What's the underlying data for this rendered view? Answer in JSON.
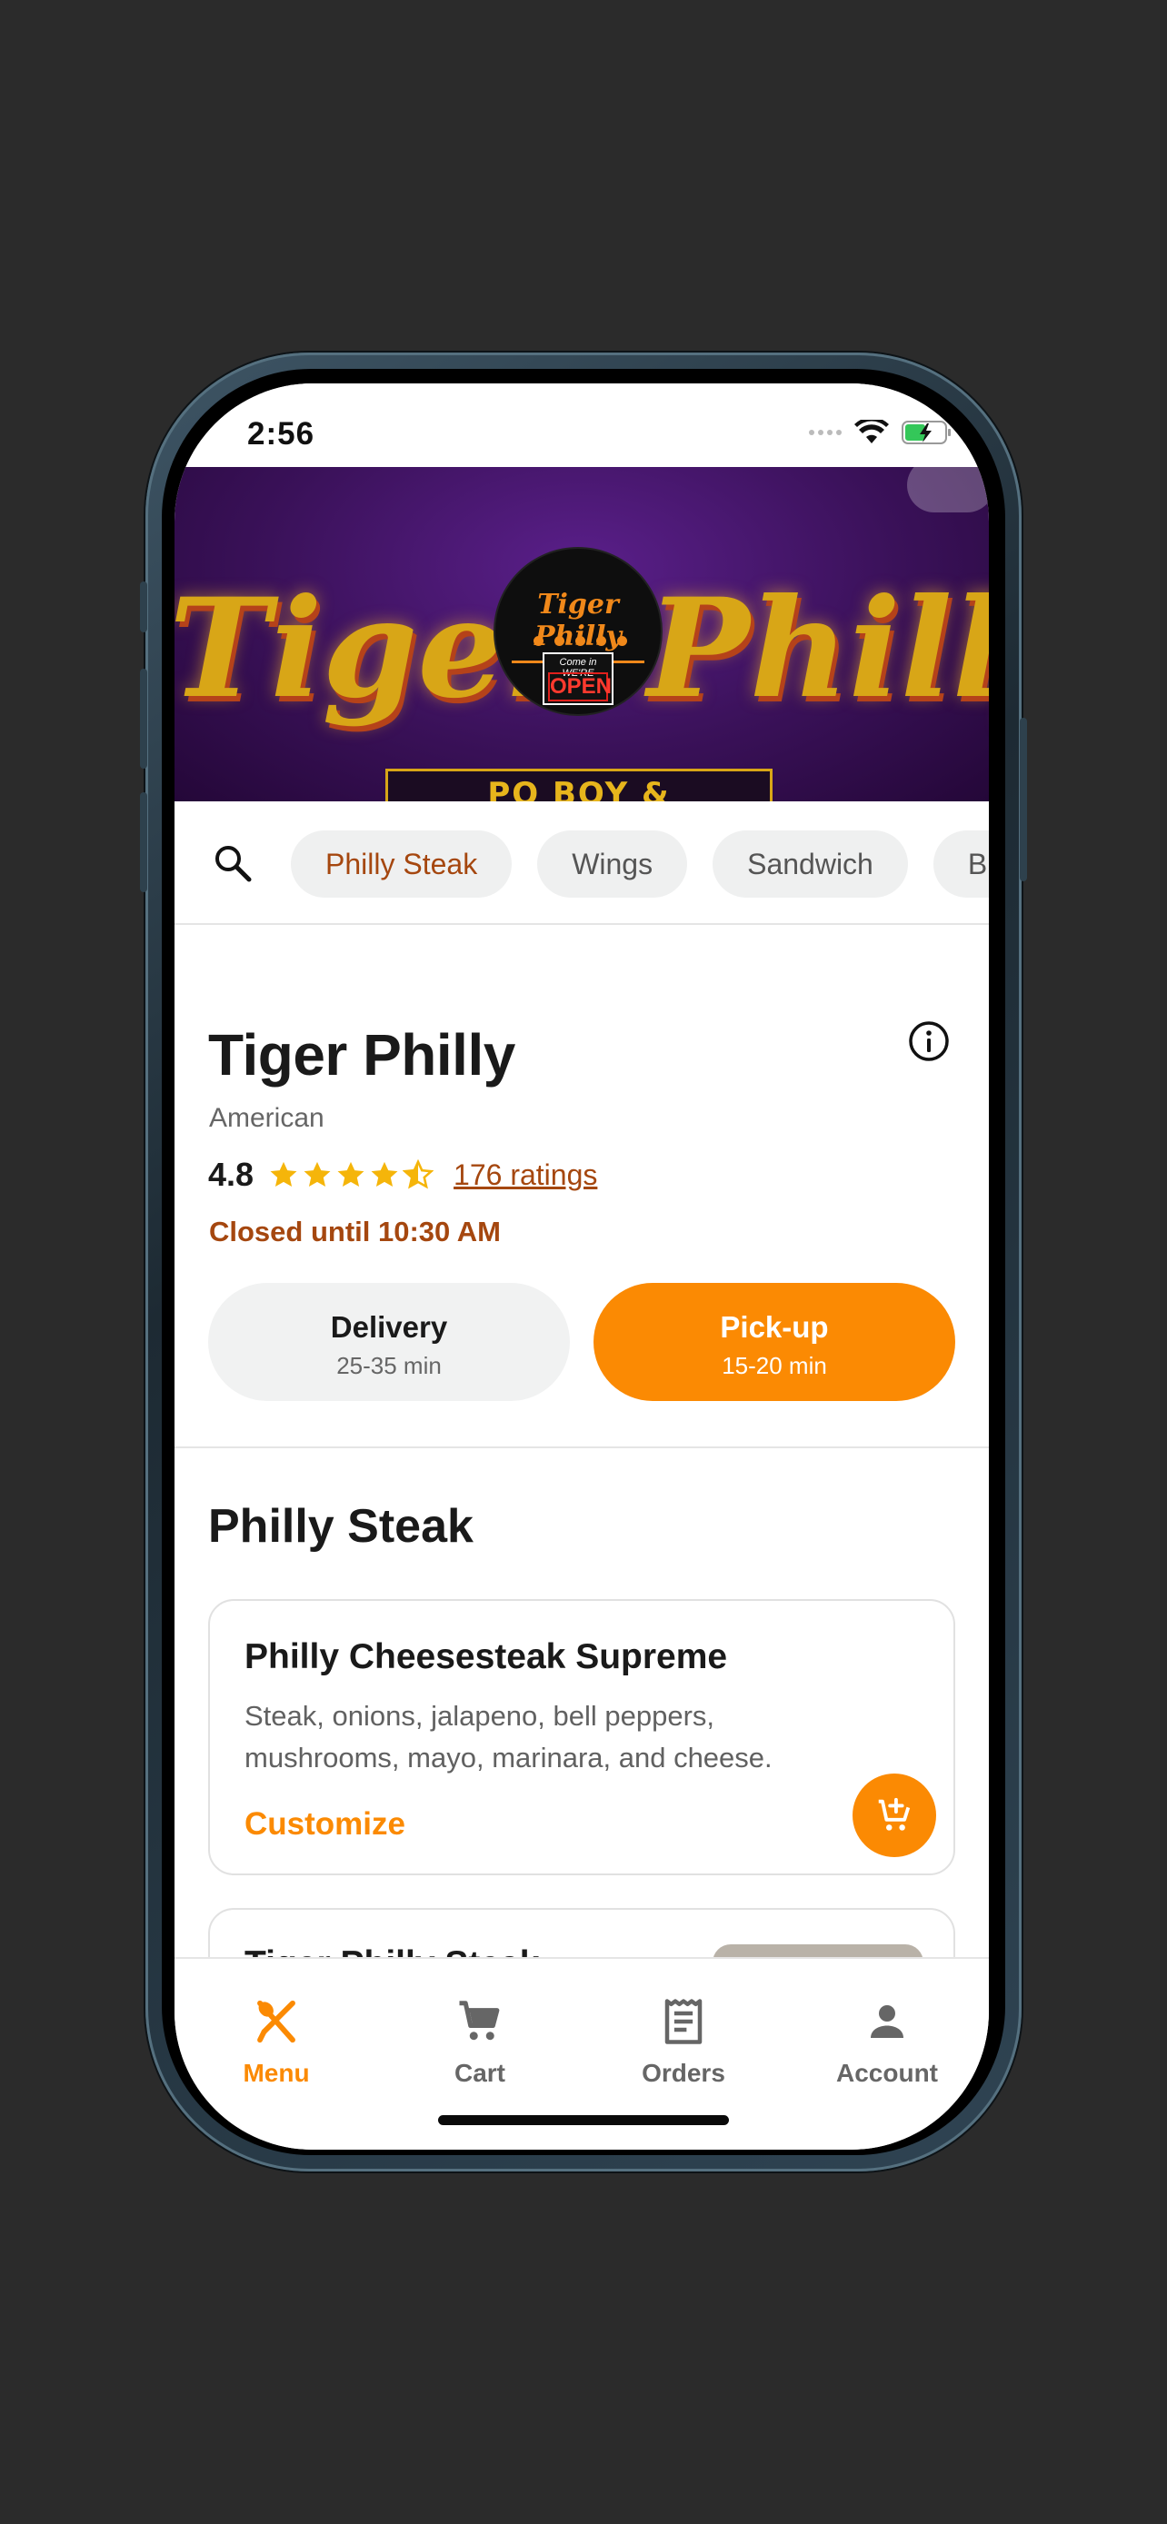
{
  "status_bar": {
    "time": "2:56"
  },
  "hero": {
    "sign_left": "Tiger",
    "sign_right": "Philly",
    "sign_sub": "PO BOY & SHAWARMA",
    "logo_title": "Tiger Philly",
    "logo_sign_top": "Come in WE'RE",
    "logo_sign_open": "OPEN"
  },
  "filters": {
    "chips": [
      "Philly Steak",
      "Wings",
      "Sandwich",
      "B"
    ]
  },
  "restaurant": {
    "name": "Tiger Philly",
    "cuisine": "American",
    "rating": "4.8",
    "stars": 4.5,
    "ratings_count": "176 ratings",
    "status": "Closed until 10:30 AM"
  },
  "order_modes": {
    "delivery": {
      "label": "Delivery",
      "time": "25-35 min"
    },
    "pickup": {
      "label": "Pick-up",
      "time": "15-20 min"
    }
  },
  "menu": {
    "section_title": "Philly Steak",
    "items": [
      {
        "name": "Philly Cheesesteak Supreme",
        "description": "Steak, onions, jalapeno, bell peppers, mushrooms, mayo, marinara, and cheese.",
        "action": "Customize"
      },
      {
        "name": "Tiger Philly Steak"
      }
    ]
  },
  "tab_bar": {
    "tabs": [
      {
        "label": "Menu",
        "icon": "fork-knife-icon"
      },
      {
        "label": "Cart",
        "icon": "cart-icon"
      },
      {
        "label": "Orders",
        "icon": "receipt-icon"
      },
      {
        "label": "Account",
        "icon": "person-icon"
      }
    ],
    "active": "Menu"
  },
  "colors": {
    "accent": "#fb8a03",
    "brown_text": "#a5470f",
    "star": "#f5b50a",
    "chip_bg": "#eff0f0"
  }
}
